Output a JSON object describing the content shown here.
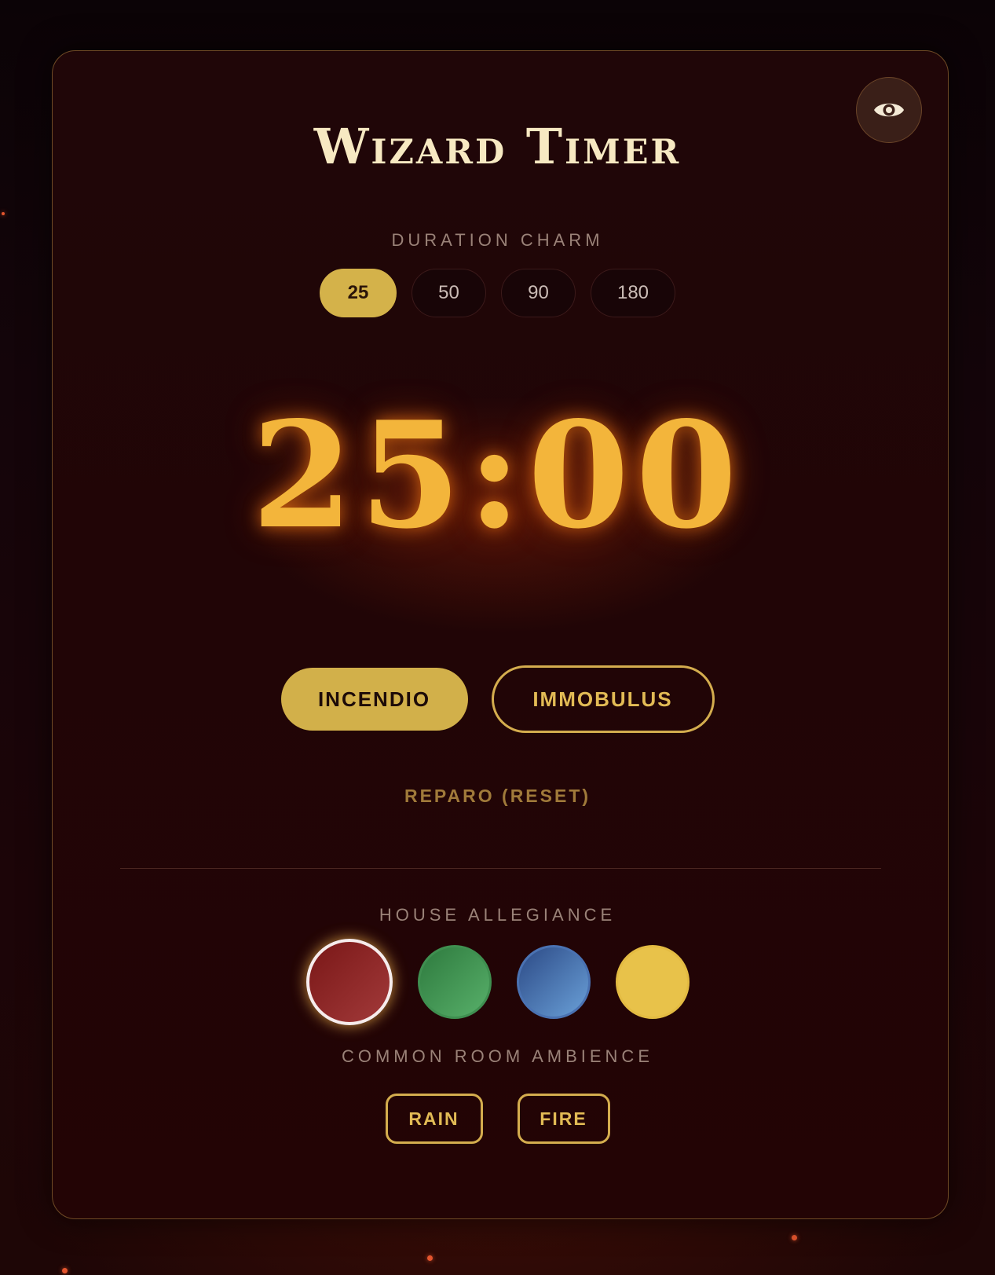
{
  "app": {
    "title": "Wizard Timer"
  },
  "duration": {
    "label": "DURATION CHARM",
    "options": [
      "25",
      "50",
      "90",
      "180"
    ],
    "selected": "25"
  },
  "timer": {
    "display": "25:00"
  },
  "actions": {
    "start_label": "INCENDIO",
    "pause_label": "IMMOBULUS",
    "reset_label": "REPARO (RESET)"
  },
  "houses": {
    "label": "HOUSE ALLEGIANCE",
    "selected": "red"
  },
  "ambience": {
    "label": "COMMON ROOM AMBIENCE",
    "rain_label": "RAIN",
    "fire_label": "FIRE"
  },
  "icons": {
    "visibility": "eye-icon"
  },
  "colors": {
    "accent_gold": "#d4b24a",
    "timer_amber": "#f3b53b",
    "house_red": "#8b2323",
    "house_green": "#46a058",
    "house_blue": "#4a78c0",
    "house_yellow": "#e8c24a"
  }
}
